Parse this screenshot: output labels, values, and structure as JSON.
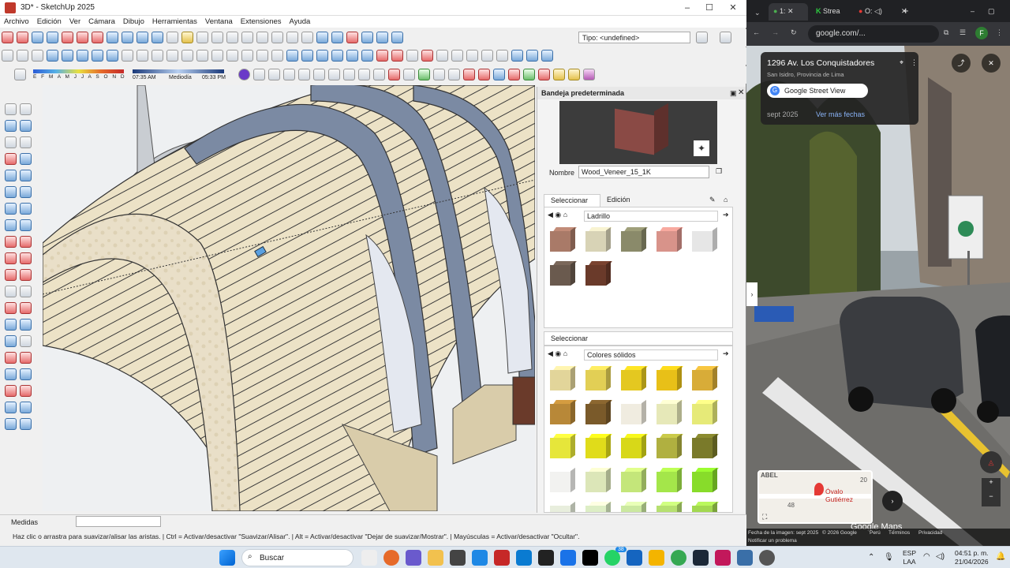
{
  "sketchup": {
    "title": "3D* - SketchUp 2025",
    "menu": [
      "Archivo",
      "Edición",
      "Ver",
      "Cámara",
      "Dibujo",
      "Herramientas",
      "Ventana",
      "Extensiones",
      "Ayuda"
    ],
    "type_field": "Tipo: <undefined>",
    "months": "E F M A M J J A S O N D",
    "time_start": "07:35 AM",
    "time_mid": "Mediodía",
    "time_end": "05:33 PM",
    "tray": {
      "title": "Bandeja predeterminada",
      "name_label": "Nombre",
      "name_value": "Wood_Veneer_15_1K",
      "tab_select": "Seleccionar",
      "tab_edit": "Edición",
      "library_1": "Ladrillo",
      "section2_title": "Seleccionar",
      "library_2": "Colores sólidos"
    },
    "measurements_label": "Medidas",
    "hint": "Haz clic o arrastra para suavizar/alisar las aristas. | Ctrl = Activar/desactivar \"Suavizar/Alisar\". | Alt = Activar/desactivar \"Dejar de suavizar/Mostrar\". | Mayúsculas = Activar/desactivar \"Ocultar\"."
  },
  "chrome": {
    "tabs": [
      "1:",
      "Strea",
      "O:"
    ],
    "url": "google.com/...",
    "place_title": "1296 Av. Los Conquistadores",
    "place_sub": "San Isidro, Provincia de Lima",
    "sv_label": "Google Street View",
    "date": "sept 2025",
    "more_dates": "Ver más fechas",
    "map_label_1": "ABEL",
    "map_label_2": "48",
    "map_label_3": "20",
    "map_place": "Óvalo Gutiérrez",
    "google_maps": "Google Maps",
    "footer_date": "Fecha de la imagen: sept 2025",
    "footer_copy": "© 2026 Google",
    "footer_peru": "Perú",
    "footer_terms": "Términos",
    "footer_privacy": "Privacidad",
    "footer_report": "Notificar un problema",
    "avatar": "F"
  },
  "taskbar": {
    "search": "Buscar",
    "lang": "ESP",
    "lang2": "LAA",
    "time": "04:51 p. m.",
    "date": "21/04/2026",
    "badge": "38"
  },
  "swatches_brick": [
    "#a97a68",
    "#d8d3b6",
    "#8a8a6a",
    "#d8938a",
    "#e6e6e6",
    "#6a5a4e",
    "#6a3a2a"
  ],
  "swatches_solid": [
    "#e2d59a",
    "#e2cf55",
    "#e4c820",
    "#e8c018",
    "#d8ac38",
    "#b88838",
    "#7a5a2a",
    "#f0ece0",
    "#e6e8b8",
    "#e6ea78",
    "#e6e63a",
    "#e0dc1a",
    "#d8d818",
    "#b0b040",
    "#7a7a2a",
    "#f2f2f0",
    "#dce6b8",
    "#c4e67a",
    "#a4e64a",
    "#88dc2a",
    "#e8eedd",
    "#ddeec5",
    "#cbe8a0",
    "#b6e070",
    "#a2d850"
  ]
}
